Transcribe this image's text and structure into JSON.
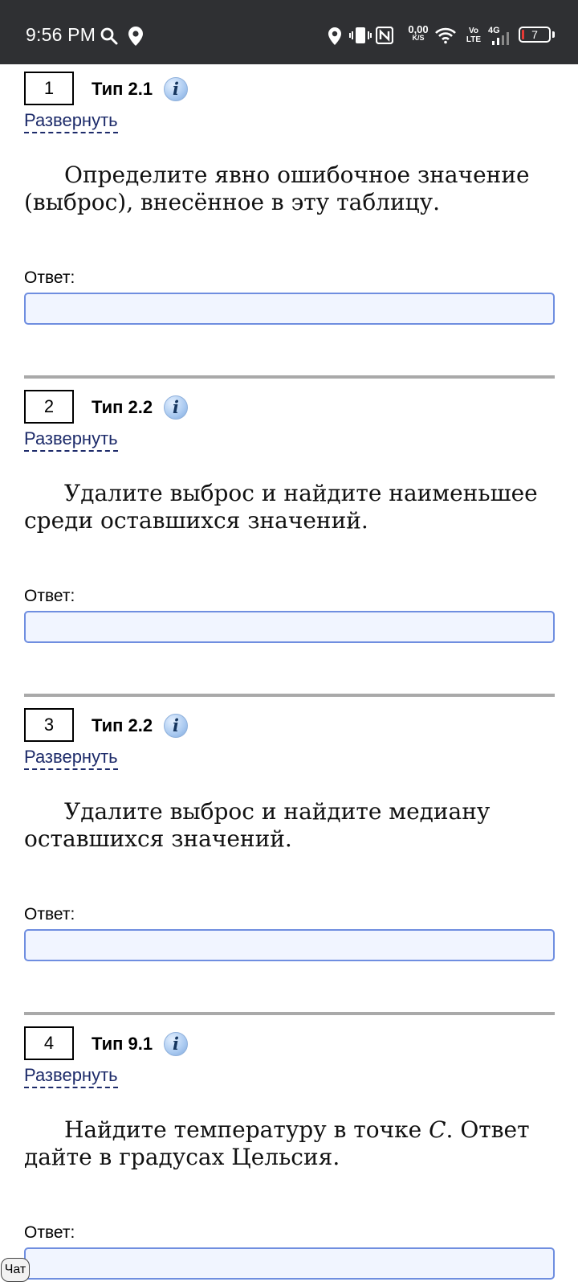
{
  "status_bar": {
    "time": "9:56 PM",
    "net_speed_value": "0,00",
    "net_speed_unit": "K/S",
    "volte_top": "Vo",
    "volte_bottom": "LTE",
    "network": "4G",
    "battery": "7",
    "icons": [
      "search-icon",
      "location-pin-icon",
      "location-icon",
      "vibrate-icon",
      "nfc-icon",
      "wifi-icon",
      "signal-icon",
      "battery-icon"
    ]
  },
  "common": {
    "expand_label": "Развернуть",
    "answer_label": "Ответ:"
  },
  "problems": [
    {
      "number": "1",
      "type": "Тип 2.1",
      "text": "Определите явно ошибочное значение (выброс), внесённое в эту таблицу."
    },
    {
      "number": "2",
      "type": "Тип 2.2",
      "text": "Удалите выброс и найдите наименьшее среди оставшихся значений."
    },
    {
      "number": "3",
      "type": "Тип 2.2",
      "text": "Удалите выброс и найдите медиану оставшихся значений."
    },
    {
      "number": "4",
      "type": "Тип 9.1",
      "text_before": "Найдите температуру в точке ",
      "text_var": "C",
      "text_after": ". Ответ дайте в градусах Цельсия."
    }
  ],
  "info_icon_glyph": "i",
  "chat_label": "Чат",
  "colors": {
    "status_bar_bg": "#2f3033",
    "link": "#1d2b6a",
    "input_border": "#6f8ee0",
    "input_bg": "#f1f5ff",
    "divider": "#a9a9a9",
    "battery_low": "#e53935"
  }
}
